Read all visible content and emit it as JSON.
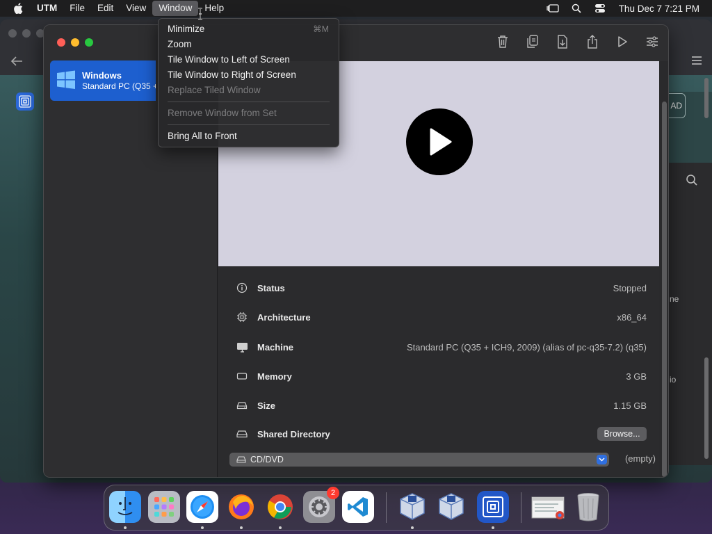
{
  "menubar": {
    "app_name": "UTM",
    "menus": [
      "File",
      "Edit",
      "View",
      "Window",
      "Help"
    ],
    "clock": "Thu Dec 7  7:21 PM"
  },
  "window_menu": {
    "minimize": "Minimize",
    "minimize_shortcut": "⌘M",
    "zoom": "Zoom",
    "tile_left": "Tile Window to Left of Screen",
    "tile_right": "Tile Window to Right of Screen",
    "replace_tiled": "Replace Tiled Window",
    "remove_from_set": "Remove Window from Set",
    "bring_all_front": "Bring All to Front"
  },
  "sidebar": {
    "vm_name": "Windows",
    "vm_desc": "Standard PC (Q35 +"
  },
  "details": {
    "status_label": "Status",
    "status_value": "Stopped",
    "architecture_label": "Architecture",
    "architecture_value": "x86_64",
    "machine_label": "Machine",
    "machine_value": "Standard PC (Q35 + ICH9, 2009) (alias of pc-q35-7.2) (q35)",
    "memory_label": "Memory",
    "memory_value": "3 GB",
    "size_label": "Size",
    "size_value": "1.15 GB",
    "shared_dir_label": "Shared Directory",
    "browse_label": "Browse...",
    "cd_label": "CD/DVD",
    "cd_value": "(empty)"
  },
  "background": {
    "load_btn_partial": "AD",
    "text_ne": "ne",
    "text_io": "io"
  },
  "dock": {
    "apps": [
      "finder-icon",
      "launchpad-icon",
      "safari-icon",
      "firefox-icon",
      "chrome-icon",
      "system-settings-icon",
      "vscode-icon",
      "virtualbox-icon",
      "virtualbox-vm-icon",
      "utm-icon",
      "screenshot-thumbnail",
      "trash-icon"
    ],
    "settings_badge": "2"
  },
  "colors": {
    "accent": "#1d5fcf",
    "close": "#ff5f57",
    "minimize": "#febc2e",
    "zoom": "#28c840"
  }
}
